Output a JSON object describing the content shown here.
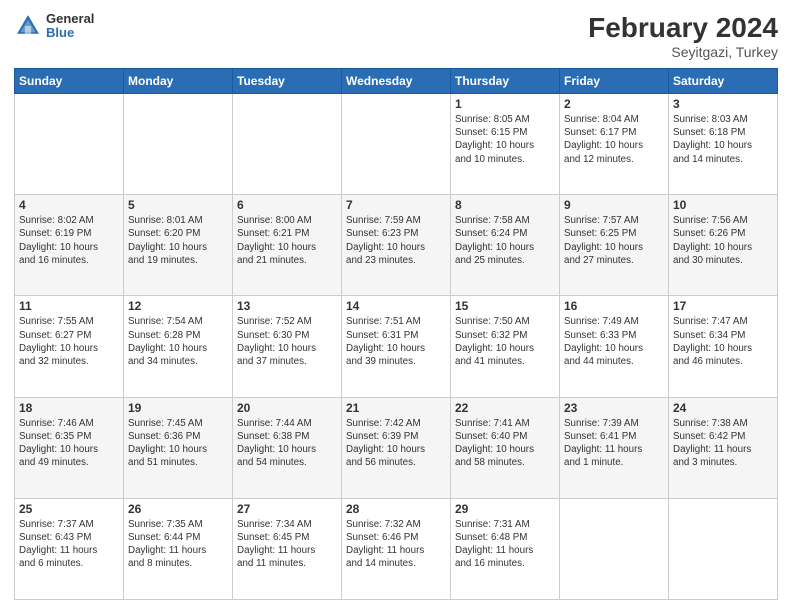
{
  "header": {
    "logo": {
      "general": "General",
      "blue": "Blue"
    },
    "title": "February 2024",
    "location": "Seyitgazi, Turkey"
  },
  "weekdays": [
    "Sunday",
    "Monday",
    "Tuesday",
    "Wednesday",
    "Thursday",
    "Friday",
    "Saturday"
  ],
  "weeks": [
    [
      {
        "day": "",
        "info": ""
      },
      {
        "day": "",
        "info": ""
      },
      {
        "day": "",
        "info": ""
      },
      {
        "day": "",
        "info": ""
      },
      {
        "day": "1",
        "info": "Sunrise: 8:05 AM\nSunset: 6:15 PM\nDaylight: 10 hours\nand 10 minutes."
      },
      {
        "day": "2",
        "info": "Sunrise: 8:04 AM\nSunset: 6:17 PM\nDaylight: 10 hours\nand 12 minutes."
      },
      {
        "day": "3",
        "info": "Sunrise: 8:03 AM\nSunset: 6:18 PM\nDaylight: 10 hours\nand 14 minutes."
      }
    ],
    [
      {
        "day": "4",
        "info": "Sunrise: 8:02 AM\nSunset: 6:19 PM\nDaylight: 10 hours\nand 16 minutes."
      },
      {
        "day": "5",
        "info": "Sunrise: 8:01 AM\nSunset: 6:20 PM\nDaylight: 10 hours\nand 19 minutes."
      },
      {
        "day": "6",
        "info": "Sunrise: 8:00 AM\nSunset: 6:21 PM\nDaylight: 10 hours\nand 21 minutes."
      },
      {
        "day": "7",
        "info": "Sunrise: 7:59 AM\nSunset: 6:23 PM\nDaylight: 10 hours\nand 23 minutes."
      },
      {
        "day": "8",
        "info": "Sunrise: 7:58 AM\nSunset: 6:24 PM\nDaylight: 10 hours\nand 25 minutes."
      },
      {
        "day": "9",
        "info": "Sunrise: 7:57 AM\nSunset: 6:25 PM\nDaylight: 10 hours\nand 27 minutes."
      },
      {
        "day": "10",
        "info": "Sunrise: 7:56 AM\nSunset: 6:26 PM\nDaylight: 10 hours\nand 30 minutes."
      }
    ],
    [
      {
        "day": "11",
        "info": "Sunrise: 7:55 AM\nSunset: 6:27 PM\nDaylight: 10 hours\nand 32 minutes."
      },
      {
        "day": "12",
        "info": "Sunrise: 7:54 AM\nSunset: 6:28 PM\nDaylight: 10 hours\nand 34 minutes."
      },
      {
        "day": "13",
        "info": "Sunrise: 7:52 AM\nSunset: 6:30 PM\nDaylight: 10 hours\nand 37 minutes."
      },
      {
        "day": "14",
        "info": "Sunrise: 7:51 AM\nSunset: 6:31 PM\nDaylight: 10 hours\nand 39 minutes."
      },
      {
        "day": "15",
        "info": "Sunrise: 7:50 AM\nSunset: 6:32 PM\nDaylight: 10 hours\nand 41 minutes."
      },
      {
        "day": "16",
        "info": "Sunrise: 7:49 AM\nSunset: 6:33 PM\nDaylight: 10 hours\nand 44 minutes."
      },
      {
        "day": "17",
        "info": "Sunrise: 7:47 AM\nSunset: 6:34 PM\nDaylight: 10 hours\nand 46 minutes."
      }
    ],
    [
      {
        "day": "18",
        "info": "Sunrise: 7:46 AM\nSunset: 6:35 PM\nDaylight: 10 hours\nand 49 minutes."
      },
      {
        "day": "19",
        "info": "Sunrise: 7:45 AM\nSunset: 6:36 PM\nDaylight: 10 hours\nand 51 minutes."
      },
      {
        "day": "20",
        "info": "Sunrise: 7:44 AM\nSunset: 6:38 PM\nDaylight: 10 hours\nand 54 minutes."
      },
      {
        "day": "21",
        "info": "Sunrise: 7:42 AM\nSunset: 6:39 PM\nDaylight: 10 hours\nand 56 minutes."
      },
      {
        "day": "22",
        "info": "Sunrise: 7:41 AM\nSunset: 6:40 PM\nDaylight: 10 hours\nand 58 minutes."
      },
      {
        "day": "23",
        "info": "Sunrise: 7:39 AM\nSunset: 6:41 PM\nDaylight: 11 hours\nand 1 minute."
      },
      {
        "day": "24",
        "info": "Sunrise: 7:38 AM\nSunset: 6:42 PM\nDaylight: 11 hours\nand 3 minutes."
      }
    ],
    [
      {
        "day": "25",
        "info": "Sunrise: 7:37 AM\nSunset: 6:43 PM\nDaylight: 11 hours\nand 6 minutes."
      },
      {
        "day": "26",
        "info": "Sunrise: 7:35 AM\nSunset: 6:44 PM\nDaylight: 11 hours\nand 8 minutes."
      },
      {
        "day": "27",
        "info": "Sunrise: 7:34 AM\nSunset: 6:45 PM\nDaylight: 11 hours\nand 11 minutes."
      },
      {
        "day": "28",
        "info": "Sunrise: 7:32 AM\nSunset: 6:46 PM\nDaylight: 11 hours\nand 14 minutes."
      },
      {
        "day": "29",
        "info": "Sunrise: 7:31 AM\nSunset: 6:48 PM\nDaylight: 11 hours\nand 16 minutes."
      },
      {
        "day": "",
        "info": ""
      },
      {
        "day": "",
        "info": ""
      }
    ]
  ]
}
